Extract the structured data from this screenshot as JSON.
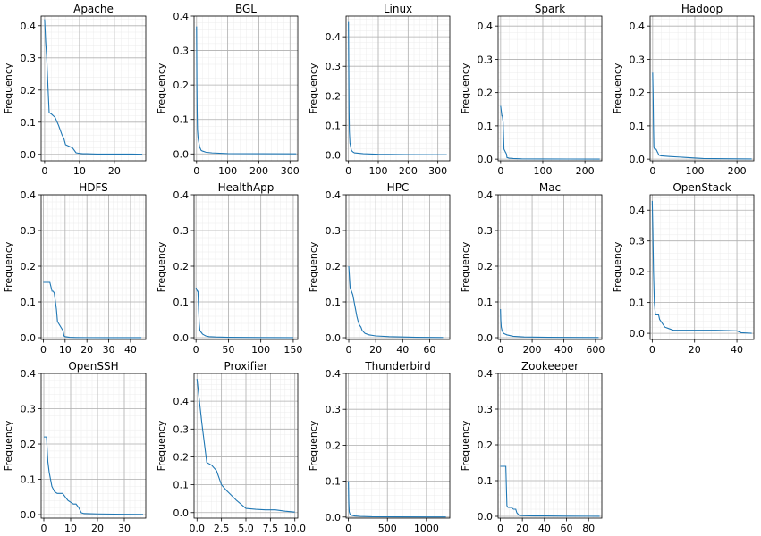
{
  "figure": {
    "ylabel": "Frequency",
    "line_color": "#1f77b4"
  },
  "chart_data": [
    {
      "type": "line",
      "title": "Apache",
      "xlabel": "",
      "ylabel": "Frequency",
      "xlim": [
        -1,
        29
      ],
      "ylim": [
        -0.02,
        0.43
      ],
      "xticks": [
        0,
        10,
        20
      ],
      "xtick_labels": [
        "0",
        "10",
        "20"
      ],
      "yticks": [
        0,
        0.1,
        0.2,
        0.3,
        0.4
      ],
      "ytick_labels": [
        "0.0",
        "0.1",
        "0.2",
        "0.3",
        "0.4"
      ],
      "series": [
        {
          "x": [
            0,
            0.3,
            0.6,
            1,
            1.3,
            2,
            3,
            4,
            5,
            5.5,
            6,
            7,
            8,
            9,
            9.5,
            10,
            11,
            12,
            15,
            20,
            25,
            28
          ],
          "y": [
            0.42,
            0.35,
            0.3,
            0.2,
            0.13,
            0.125,
            0.115,
            0.09,
            0.06,
            0.05,
            0.03,
            0.025,
            0.02,
            0.005,
            0.004,
            0.003,
            0.002,
            0.002,
            0.001,
            0.001,
            0.001,
            0.0005
          ]
        }
      ]
    },
    {
      "type": "line",
      "title": "BGL",
      "xlabel": "",
      "ylabel": "Frequency",
      "xlim": [
        -8,
        325
      ],
      "ylim": [
        -0.02,
        0.4
      ],
      "xticks": [
        0,
        100,
        200,
        300
      ],
      "xtick_labels": [
        "0",
        "100",
        "200",
        "300"
      ],
      "yticks": [
        0,
        0.1,
        0.2,
        0.3,
        0.4
      ],
      "ytick_labels": [
        "0.0",
        "0.1",
        "0.2",
        "0.3",
        "0.4"
      ],
      "series": [
        {
          "x": [
            0,
            1,
            2,
            3,
            5,
            8,
            10,
            15,
            20,
            30,
            50,
            100,
            200,
            320
          ],
          "y": [
            0.37,
            0.2,
            0.12,
            0.07,
            0.045,
            0.03,
            0.02,
            0.01,
            0.008,
            0.005,
            0.003,
            0.001,
            0.0005,
            0.0002
          ]
        }
      ]
    },
    {
      "type": "line",
      "title": "Linux",
      "xlabel": "",
      "ylabel": "Frequency",
      "xlim": [
        -8,
        340
      ],
      "ylim": [
        -0.02,
        0.47
      ],
      "xticks": [
        0,
        100,
        200,
        300
      ],
      "xtick_labels": [
        "0",
        "100",
        "200",
        "300"
      ],
      "yticks": [
        0,
        0.1,
        0.2,
        0.3,
        0.4
      ],
      "ytick_labels": [
        "0.0",
        "0.1",
        "0.2",
        "0.3",
        "0.4"
      ],
      "series": [
        {
          "x": [
            0,
            1,
            2,
            3,
            5,
            8,
            10,
            15,
            20,
            50,
            100,
            200,
            330
          ],
          "y": [
            0.45,
            0.3,
            0.15,
            0.08,
            0.04,
            0.025,
            0.015,
            0.01,
            0.007,
            0.004,
            0.002,
            0.001,
            0.0005
          ]
        }
      ]
    },
    {
      "type": "line",
      "title": "Spark",
      "xlabel": "",
      "ylabel": "Frequency",
      "xlim": [
        -6,
        240
      ],
      "ylim": [
        -0.005,
        0.43
      ],
      "xticks": [
        0,
        100,
        200
      ],
      "xtick_labels": [
        "0",
        "100",
        "200"
      ],
      "yticks": [
        0,
        0.1,
        0.2,
        0.3,
        0.4
      ],
      "ytick_labels": [
        "0.0",
        "0.1",
        "0.2",
        "0.3",
        "0.4"
      ],
      "series": [
        {
          "x": [
            0,
            1,
            2,
            3,
            4,
            6,
            8,
            10,
            12,
            14,
            15,
            20,
            30,
            50,
            100,
            235
          ],
          "y": [
            0.16,
            0.15,
            0.14,
            0.13,
            0.13,
            0.11,
            0.03,
            0.025,
            0.02,
            0.015,
            0.005,
            0.003,
            0.002,
            0.001,
            0.0005,
            0.0002
          ]
        }
      ]
    },
    {
      "type": "line",
      "title": "Hadoop",
      "xlabel": "",
      "ylabel": "Frequency",
      "xlim": [
        -6,
        240
      ],
      "ylim": [
        -0.005,
        0.43
      ],
      "xticks": [
        0,
        100,
        200
      ],
      "xtick_labels": [
        "0",
        "100",
        "200"
      ],
      "yticks": [
        0,
        0.1,
        0.2,
        0.3,
        0.4
      ],
      "ytick_labels": [
        "0.0",
        "0.1",
        "0.2",
        "0.3",
        "0.4"
      ],
      "series": [
        {
          "x": [
            0,
            1,
            2,
            3,
            5,
            8,
            12,
            15,
            20,
            40,
            80,
            120,
            200,
            235
          ],
          "y": [
            0.26,
            0.2,
            0.1,
            0.035,
            0.03,
            0.03,
            0.02,
            0.012,
            0.01,
            0.008,
            0.005,
            0.002,
            0.001,
            0.0005
          ]
        }
      ]
    },
    {
      "type": "line",
      "title": "HDFS",
      "xlabel": "",
      "ylabel": "Frequency",
      "xlim": [
        -1,
        47
      ],
      "ylim": [
        -0.005,
        0.4
      ],
      "xticks": [
        0,
        10,
        20,
        30,
        40
      ],
      "xtick_labels": [
        "0",
        "10",
        "20",
        "30",
        "40"
      ],
      "yticks": [
        0,
        0.1,
        0.2,
        0.3,
        0.4
      ],
      "ytick_labels": [
        "0.0",
        "0.1",
        "0.2",
        "0.3",
        "0.4"
      ],
      "series": [
        {
          "x": [
            0,
            1,
            2,
            3,
            4,
            4.5,
            5,
            6,
            6.5,
            7,
            8,
            9,
            9.5,
            10,
            11,
            12,
            15,
            20,
            30,
            40,
            45
          ],
          "y": [
            0.155,
            0.155,
            0.155,
            0.155,
            0.13,
            0.13,
            0.125,
            0.08,
            0.045,
            0.04,
            0.03,
            0.02,
            0.005,
            0.003,
            0.002,
            0.001,
            0.0005,
            0.0003,
            0.0002,
            0.0001,
            0.0001
          ]
        }
      ]
    },
    {
      "type": "line",
      "title": "HealthApp",
      "xlabel": "",
      "ylabel": "Frequency",
      "xlim": [
        -3,
        157
      ],
      "ylim": [
        -0.005,
        0.4
      ],
      "xticks": [
        0,
        50,
        100,
        150
      ],
      "xtick_labels": [
        "0",
        "50",
        "100",
        "150"
      ],
      "yticks": [
        0,
        0.1,
        0.2,
        0.3,
        0.4
      ],
      "ytick_labels": [
        "0.0",
        "0.1",
        "0.2",
        "0.3",
        "0.4"
      ],
      "series": [
        {
          "x": [
            0,
            1,
            2,
            3,
            4,
            5,
            6,
            8,
            10,
            12,
            15,
            20,
            30,
            50,
            100,
            150
          ],
          "y": [
            0.14,
            0.135,
            0.13,
            0.13,
            0.08,
            0.04,
            0.02,
            0.015,
            0.01,
            0.008,
            0.005,
            0.003,
            0.002,
            0.001,
            0.0005,
            0.0002
          ]
        }
      ]
    },
    {
      "type": "line",
      "title": "HPC",
      "xlabel": "",
      "ylabel": "Frequency",
      "xlim": [
        -2,
        75
      ],
      "ylim": [
        -0.005,
        0.4
      ],
      "xticks": [
        0,
        20,
        40,
        60
      ],
      "xtick_labels": [
        "0",
        "20",
        "40",
        "60"
      ],
      "yticks": [
        0,
        0.1,
        0.2,
        0.3,
        0.4
      ],
      "ytick_labels": [
        "0.0",
        "0.1",
        "0.2",
        "0.3",
        "0.4"
      ],
      "series": [
        {
          "x": [
            0,
            1,
            2,
            3,
            4,
            5,
            6,
            7,
            8,
            9,
            10,
            12,
            15,
            20,
            30,
            40,
            50,
            70
          ],
          "y": [
            0.2,
            0.14,
            0.13,
            0.12,
            0.1,
            0.08,
            0.06,
            0.045,
            0.035,
            0.03,
            0.02,
            0.012,
            0.008,
            0.005,
            0.003,
            0.002,
            0.001,
            0.0005
          ]
        }
      ]
    },
    {
      "type": "line",
      "title": "Mac",
      "xlabel": "",
      "ylabel": "Frequency",
      "xlim": [
        -15,
        640
      ],
      "ylim": [
        -0.005,
        0.4
      ],
      "xticks": [
        0,
        200,
        400,
        600
      ],
      "xtick_labels": [
        "0",
        "200",
        "400",
        "600"
      ],
      "yticks": [
        0,
        0.1,
        0.2,
        0.3,
        0.4
      ],
      "ytick_labels": [
        "0.0",
        "0.1",
        "0.2",
        "0.3",
        "0.4"
      ],
      "series": [
        {
          "x": [
            0,
            2,
            5,
            10,
            20,
            40,
            80,
            150,
            300,
            620
          ],
          "y": [
            0.08,
            0.05,
            0.03,
            0.02,
            0.012,
            0.008,
            0.004,
            0.002,
            0.001,
            0.0005
          ]
        }
      ]
    },
    {
      "type": "line",
      "title": "OpenStack",
      "xlabel": "",
      "ylabel": "Frequency",
      "xlim": [
        -1,
        48
      ],
      "ylim": [
        -0.02,
        0.45
      ],
      "xticks": [
        0,
        20,
        40
      ],
      "xtick_labels": [
        "0",
        "20",
        "40"
      ],
      "yticks": [
        0,
        0.1,
        0.2,
        0.3,
        0.4
      ],
      "ytick_labels": [
        "0.0",
        "0.1",
        "0.2",
        "0.3",
        "0.4"
      ],
      "series": [
        {
          "x": [
            0,
            0.3,
            0.6,
            1,
            1.5,
            2,
            3,
            3.5,
            4,
            5,
            6,
            8,
            10,
            15,
            20,
            30,
            40,
            42,
            47
          ],
          "y": [
            0.43,
            0.33,
            0.2,
            0.1,
            0.06,
            0.06,
            0.06,
            0.045,
            0.04,
            0.03,
            0.02,
            0.015,
            0.01,
            0.01,
            0.01,
            0.01,
            0.008,
            0.002,
            0.0
          ]
        }
      ]
    },
    {
      "type": "line",
      "title": "OpenSSH",
      "xlabel": "",
      "ylabel": "Frequency",
      "xlim": [
        -1,
        38
      ],
      "ylim": [
        -0.01,
        0.4
      ],
      "xticks": [
        0,
        10,
        20,
        30
      ],
      "xtick_labels": [
        "0",
        "10",
        "20",
        "30"
      ],
      "yticks": [
        0,
        0.1,
        0.2,
        0.3,
        0.4
      ],
      "ytick_labels": [
        "0.0",
        "0.1",
        "0.2",
        "0.3",
        "0.4"
      ],
      "series": [
        {
          "x": [
            0,
            1,
            1.5,
            2,
            3,
            4,
            5,
            6,
            7,
            8,
            9,
            10,
            11,
            12,
            13,
            14,
            15,
            20,
            30,
            37
          ],
          "y": [
            0.22,
            0.22,
            0.15,
            0.12,
            0.08,
            0.065,
            0.06,
            0.06,
            0.06,
            0.05,
            0.04,
            0.035,
            0.03,
            0.03,
            0.02,
            0.005,
            0.003,
            0.002,
            0.001,
            0.0005
          ]
        }
      ]
    },
    {
      "type": "line",
      "title": "Proxifier",
      "xlabel": "",
      "ylabel": "Frequency",
      "xlim": [
        -0.3,
        10.3
      ],
      "ylim": [
        -0.02,
        0.5
      ],
      "xticks": [
        0,
        2.5,
        5,
        7.5,
        10
      ],
      "xtick_labels": [
        "0.0",
        "2.5",
        "5.0",
        "7.5",
        "10.0"
      ],
      "yticks": [
        0,
        0.1,
        0.2,
        0.3,
        0.4
      ],
      "ytick_labels": [
        "0.0",
        "0.1",
        "0.2",
        "0.3",
        "0.4"
      ],
      "series": [
        {
          "x": [
            0,
            0.5,
            1,
            1.5,
            2,
            2.5,
            3,
            4,
            5,
            6,
            7,
            8,
            9,
            10
          ],
          "y": [
            0.48,
            0.32,
            0.18,
            0.17,
            0.15,
            0.1,
            0.08,
            0.045,
            0.015,
            0.012,
            0.01,
            0.01,
            0.005,
            0.002
          ]
        }
      ]
    },
    {
      "type": "line",
      "title": "Thunderbird",
      "xlabel": "",
      "ylabel": "Frequency",
      "xlim": [
        -30,
        1300
      ],
      "ylim": [
        -0.003,
        0.4
      ],
      "xticks": [
        0,
        500,
        1000
      ],
      "xtick_labels": [
        "0",
        "500",
        "1000"
      ],
      "yticks": [
        0,
        0.1,
        0.2,
        0.3,
        0.4
      ],
      "ytick_labels": [
        "0.0",
        "0.1",
        "0.2",
        "0.3",
        "0.4"
      ],
      "series": [
        {
          "x": [
            0,
            5,
            10,
            20,
            40,
            80,
            150,
            300,
            600,
            1000,
            1250
          ],
          "y": [
            0.1,
            0.04,
            0.015,
            0.008,
            0.005,
            0.003,
            0.002,
            0.001,
            0.0005,
            0.0003,
            0.0002
          ]
        }
      ]
    },
    {
      "type": "line",
      "title": "Zookeeper",
      "xlabel": "",
      "ylabel": "Frequency",
      "xlim": [
        -2,
        92
      ],
      "ylim": [
        -0.005,
        0.4
      ],
      "xticks": [
        0,
        20,
        40,
        60,
        80
      ],
      "xtick_labels": [
        "0",
        "20",
        "40",
        "60",
        "80"
      ],
      "yticks": [
        0,
        0.1,
        0.2,
        0.3,
        0.4
      ],
      "ytick_labels": [
        "0.0",
        "0.1",
        "0.2",
        "0.3",
        "0.4"
      ],
      "series": [
        {
          "x": [
            0,
            1,
            2,
            3,
            4,
            5,
            6,
            7,
            8,
            10,
            12,
            14,
            15,
            17,
            20,
            30,
            40,
            60,
            80,
            90
          ],
          "y": [
            0.14,
            0.14,
            0.14,
            0.14,
            0.14,
            0.14,
            0.03,
            0.025,
            0.025,
            0.025,
            0.02,
            0.02,
            0.01,
            0.003,
            0.002,
            0.001,
            0.001,
            0.0005,
            0.0003,
            0.0002
          ]
        }
      ]
    }
  ]
}
